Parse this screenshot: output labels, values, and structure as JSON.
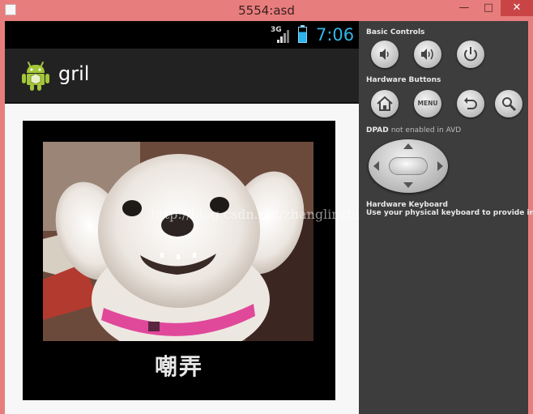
{
  "window": {
    "title": "5554:asd",
    "minimize_glyph": "—",
    "maximize_glyph": "□",
    "close_glyph": "✕"
  },
  "statusbar": {
    "network": "3G",
    "time": "7:06"
  },
  "app": {
    "title": "gril",
    "icon": "android-robot-icon"
  },
  "content": {
    "caption": "嘲弄",
    "watermark": "http://blog.csdn.net/zhanglinzhi"
  },
  "panel": {
    "basic_controls_label": "Basic Controls",
    "hardware_buttons_label": "Hardware Buttons",
    "dpad_label": "DPAD",
    "dpad_status": "not enabled in AVD",
    "hardware_keyboard_label": "Hardware Keyboard",
    "keyboard_hint": "Use your physical keyboard to provide input",
    "menu_label": "MENU"
  },
  "colors": {
    "window_frame": "#e87d7d",
    "accent_holo_blue": "#33b5e5",
    "action_bar": "#222222",
    "panel_bg": "#3d3d3d"
  }
}
